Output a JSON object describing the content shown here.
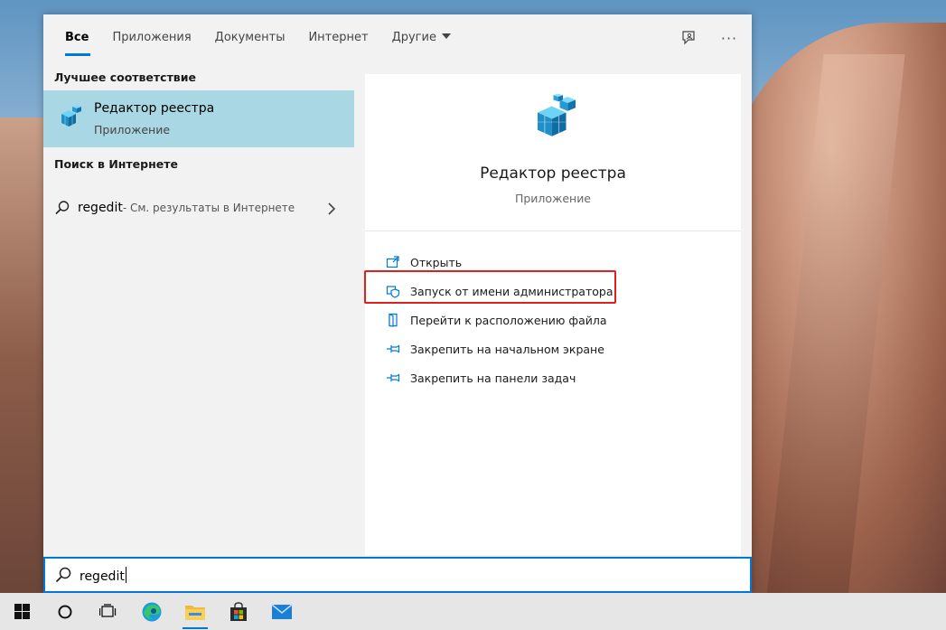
{
  "tabs": [
    {
      "label": "Все",
      "active": true
    },
    {
      "label": "Приложения",
      "active": false
    },
    {
      "label": "Документы",
      "active": false
    },
    {
      "label": "Интернет",
      "active": false
    },
    {
      "label": "Другие",
      "active": false
    }
  ],
  "toolbar": {
    "more_label": "···"
  },
  "left": {
    "best_match_title": "Лучшее соответствие",
    "best_match": {
      "name": "Редактор реестра",
      "type": "Приложение"
    },
    "web_title": "Поиск в Интернете",
    "web_result": {
      "query": "regedit",
      "hint": " - См. результаты в Интернете"
    }
  },
  "preview": {
    "title": "Редактор реестра",
    "subtitle": "Приложение",
    "actions": [
      {
        "label": "Открыть",
        "icon": "open-icon"
      },
      {
        "label": "Запуск от имени администратора",
        "icon": "shield-icon"
      },
      {
        "label": "Перейти к расположению файла",
        "icon": "file-location-icon"
      },
      {
        "label": "Закрепить на начальном экране",
        "icon": "pin-icon"
      },
      {
        "label": "Закрепить на панели задач",
        "icon": "pin-icon"
      }
    ]
  },
  "search": {
    "value": "regedit"
  },
  "colors": {
    "accent": "#0078d7",
    "selection": "#a9d7e3",
    "highlight_border": "#e0201f"
  },
  "taskbar": {
    "items": [
      "windows-start-icon",
      "cortana-icon",
      "task-view-icon",
      "edge-icon",
      "file-explorer-icon",
      "store-icon",
      "mail-icon"
    ]
  }
}
